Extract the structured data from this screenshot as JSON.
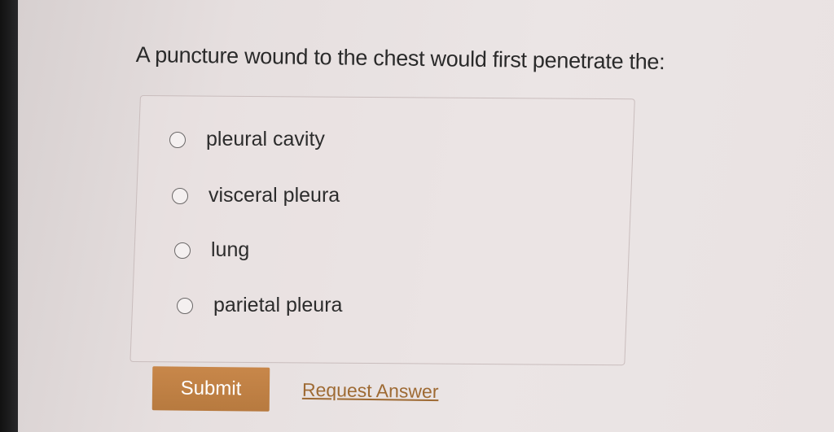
{
  "question": {
    "text": "A puncture wound to the chest would first penetrate the:"
  },
  "options": [
    {
      "label": "pleural cavity",
      "selected": false
    },
    {
      "label": "visceral pleura",
      "selected": false
    },
    {
      "label": "lung",
      "selected": false
    },
    {
      "label": "parietal pleura",
      "selected": false
    }
  ],
  "actions": {
    "submit_label": "Submit",
    "request_answer_label": "Request Answer"
  },
  "colors": {
    "accent": "#b77a3f",
    "link": "#9e6a33"
  }
}
